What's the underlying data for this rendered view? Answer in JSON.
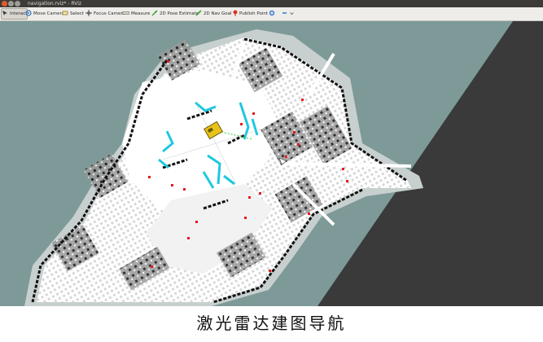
{
  "window": {
    "title": "navigation.rviz* - RViz"
  },
  "toolbar": {
    "tools": [
      {
        "label": "Interact",
        "icon": "interact-icon",
        "active": true
      },
      {
        "label": "Move Camera",
        "icon": "move-camera-icon"
      },
      {
        "label": "Select",
        "icon": "select-icon"
      },
      {
        "label": "Focus Camera",
        "icon": "focus-camera-icon"
      },
      {
        "label": "Measure",
        "icon": "measure-icon"
      },
      {
        "label": "2D Pose Estimate",
        "icon": "pose-estimate-icon"
      },
      {
        "label": "2D Nav Goal",
        "icon": "nav-goal-icon"
      },
      {
        "label": "Publish Point",
        "icon": "publish-point-icon"
      }
    ]
  },
  "map": {
    "background_color": "#7d9a98",
    "free_color": "#ffffff",
    "unknown_color": "#9a9a9a",
    "obstacle_color": "#111111",
    "laser_color": "#e8181c",
    "inflation_color": "#1ec8e0",
    "robot_color": "#e8c21a"
  },
  "caption": "激光雷达建图导航"
}
